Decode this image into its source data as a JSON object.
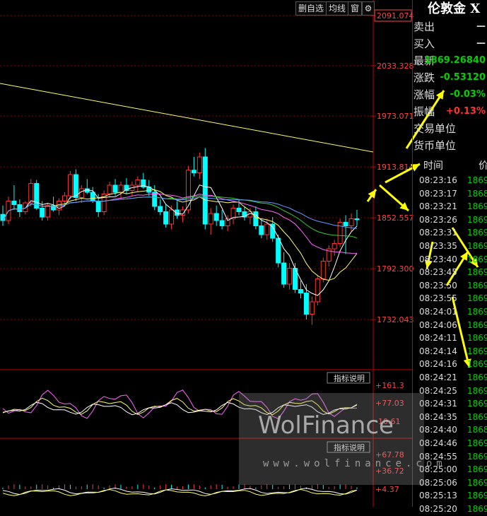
{
  "toolbar": {
    "del_fav": "删自选",
    "ma": "均线",
    "win_icon": "窗",
    "settings_icon": "gear-icon"
  },
  "quote": {
    "title": "伦敦金 X",
    "rows": [
      {
        "label": "卖出",
        "value": "—",
        "color": "#ddd"
      },
      {
        "label": "买入",
        "value": "—",
        "color": "#ddd"
      },
      {
        "label": "最新",
        "value": "1869.26840",
        "color": "#00d000"
      },
      {
        "label": "涨跌",
        "value": "-0.53120",
        "color": "#00d000"
      },
      {
        "label": "涨幅",
        "value": "-0.03%",
        "color": "#00d000"
      },
      {
        "label": "振幅",
        "value": "+0.13%",
        "color": "#ff3333"
      },
      {
        "label": "交易单位",
        "value": "",
        "color": "#ddd"
      },
      {
        "label": "货币单位",
        "value": "",
        "color": "#ddd"
      }
    ]
  },
  "ticks": {
    "header": {
      "time": "时间",
      "price": "价"
    },
    "rows": [
      {
        "time": "08:23:16",
        "price": "1869."
      },
      {
        "time": "08:23:17",
        "price": "1868."
      },
      {
        "time": "08:23:21",
        "price": "1869."
      },
      {
        "time": "08:23:26",
        "price": "1869."
      },
      {
        "time": "08:23:31",
        "price": "1869."
      },
      {
        "time": "08:23:35",
        "price": "1869."
      },
      {
        "time": "08:23:40",
        "price": "1869."
      },
      {
        "time": "08:23:45",
        "price": "1869."
      },
      {
        "time": "08:23:50",
        "price": "1869."
      },
      {
        "time": "08:23:55",
        "price": "1869."
      },
      {
        "time": "08:24:01",
        "price": "1869."
      },
      {
        "time": "08:24:06",
        "price": "1869."
      },
      {
        "time": "08:24:11",
        "price": "1869."
      },
      {
        "time": "08:24:14",
        "price": "1869."
      },
      {
        "time": "08:24:16",
        "price": "1869."
      },
      {
        "time": "08:24:21",
        "price": "1869."
      },
      {
        "time": "08:24:25",
        "price": "1869."
      },
      {
        "time": "08:24:31",
        "price": "1869."
      },
      {
        "time": "08:24:35",
        "price": "1869."
      },
      {
        "time": "08:24:40",
        "price": "1868."
      },
      {
        "time": "08:24:46",
        "price": "1869."
      },
      {
        "time": "08:24:55",
        "price": "1869."
      },
      {
        "time": "08:25:00",
        "price": "1869."
      },
      {
        "time": "08:25:06",
        "price": "1869."
      },
      {
        "time": "08:25:13",
        "price": "1869."
      },
      {
        "time": "08:25:20",
        "price": "1869."
      }
    ]
  },
  "watermark": {
    "logo": "WolFinance",
    "url": "www.wolfinance.com"
  },
  "colors": {
    "up": "#ff3333",
    "down": "#00ffff",
    "grid": "#8b0000",
    "axis": "#c00000",
    "ma_yellow": "#ffff66",
    "ma_white": "#ffffff",
    "ma_pink": "#ff66ff",
    "ma_green": "#33cc33",
    "ma_blue": "#6699ff",
    "arrow": "#ffff00"
  },
  "chart_data": {
    "type": "candlestick",
    "price_axis": {
      "ylim": [
        1700,
        2100
      ],
      "ticks": [
        "2091.074",
        "2033.328",
        "1973.071",
        "1913.814",
        "1852.557",
        "1792.300",
        "1732.043"
      ]
    },
    "ohlc": [
      [
        1875,
        1885,
        1862,
        1868
      ],
      [
        1868,
        1895,
        1864,
        1890
      ],
      [
        1890,
        1908,
        1880,
        1886
      ],
      [
        1886,
        1892,
        1872,
        1878
      ],
      [
        1878,
        1890,
        1875,
        1888
      ],
      [
        1888,
        1915,
        1884,
        1910
      ],
      [
        1910,
        1914,
        1880,
        1882
      ],
      [
        1882,
        1890,
        1868,
        1872
      ],
      [
        1872,
        1888,
        1868,
        1885
      ],
      [
        1885,
        1895,
        1878,
        1880
      ],
      [
        1880,
        1893,
        1874,
        1890
      ],
      [
        1890,
        1900,
        1886,
        1896
      ],
      [
        1896,
        1924,
        1892,
        1920
      ],
      [
        1920,
        1926,
        1890,
        1894
      ],
      [
        1894,
        1908,
        1888,
        1904
      ],
      [
        1904,
        1915,
        1898,
        1900
      ],
      [
        1900,
        1906,
        1888,
        1890
      ],
      [
        1890,
        1898,
        1872,
        1878
      ],
      [
        1878,
        1902,
        1874,
        1898
      ],
      [
        1898,
        1912,
        1894,
        1908
      ],
      [
        1908,
        1915,
        1896,
        1900
      ],
      [
        1900,
        1912,
        1892,
        1908
      ],
      [
        1908,
        1916,
        1898,
        1902
      ],
      [
        1902,
        1912,
        1896,
        1908
      ],
      [
        1908,
        1918,
        1900,
        1914
      ],
      [
        1914,
        1922,
        1904,
        1906
      ],
      [
        1906,
        1914,
        1896,
        1900
      ],
      [
        1900,
        1908,
        1880,
        1884
      ],
      [
        1884,
        1892,
        1874,
        1878
      ],
      [
        1878,
        1886,
        1860,
        1864
      ],
      [
        1864,
        1885,
        1858,
        1880
      ],
      [
        1880,
        1890,
        1870,
        1874
      ],
      [
        1874,
        1884,
        1866,
        1880
      ],
      [
        1880,
        1930,
        1876,
        1925
      ],
      [
        1925,
        1940,
        1918,
        1922
      ],
      [
        1922,
        1945,
        1915,
        1940
      ],
      [
        1940,
        1950,
        1858,
        1864
      ],
      [
        1864,
        1882,
        1852,
        1876
      ],
      [
        1876,
        1885,
        1862,
        1868
      ],
      [
        1868,
        1880,
        1858,
        1862
      ],
      [
        1862,
        1874,
        1856,
        1870
      ],
      [
        1870,
        1886,
        1864,
        1882
      ],
      [
        1882,
        1892,
        1874,
        1878
      ],
      [
        1878,
        1884,
        1868,
        1872
      ],
      [
        1872,
        1882,
        1864,
        1878
      ],
      [
        1878,
        1884,
        1858,
        1862
      ],
      [
        1862,
        1870,
        1848,
        1852
      ],
      [
        1852,
        1870,
        1846,
        1864
      ],
      [
        1864,
        1872,
        1844,
        1848
      ],
      [
        1848,
        1852,
        1815,
        1820
      ],
      [
        1820,
        1832,
        1792,
        1796
      ],
      [
        1796,
        1820,
        1790,
        1814
      ],
      [
        1814,
        1820,
        1786,
        1790
      ],
      [
        1790,
        1800,
        1780,
        1786
      ],
      [
        1786,
        1796,
        1756,
        1762
      ],
      [
        1762,
        1782,
        1750,
        1776
      ],
      [
        1776,
        1806,
        1772,
        1802
      ],
      [
        1802,
        1826,
        1798,
        1822
      ],
      [
        1822,
        1840,
        1816,
        1836
      ],
      [
        1836,
        1846,
        1828,
        1842
      ],
      [
        1842,
        1870,
        1838,
        1866
      ],
      [
        1866,
        1874,
        1830,
        1862
      ],
      [
        1862,
        1876,
        1856,
        1870
      ],
      [
        1870,
        1880,
        1862,
        1869
      ]
    ],
    "indicator1": {
      "label": "指标说明",
      "ticks": [
        "+161.3",
        "+77.03",
        "-10.61"
      ]
    },
    "indicator2": {
      "label": "指标说明",
      "ticks": [
        "+67.78",
        "+36.72",
        "+4.37"
      ]
    }
  }
}
